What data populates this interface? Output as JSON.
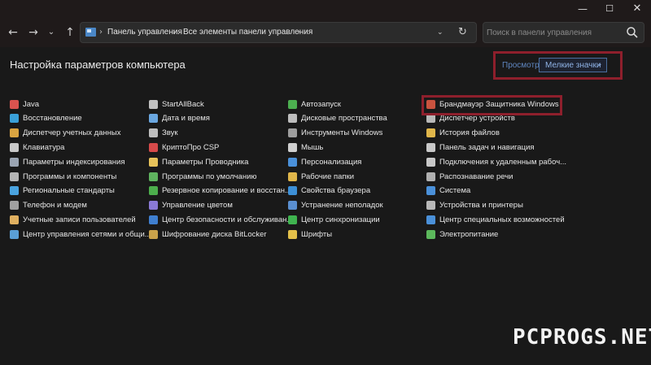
{
  "window": {
    "minimize_glyph": "—",
    "maximize_glyph": "☐",
    "close_glyph": "✕"
  },
  "nav": {
    "back_glyph": "←",
    "forward_glyph": "→",
    "recent_glyph": "⌄",
    "up_glyph": "↑"
  },
  "address": {
    "crumbs": [
      "Панель управления",
      "Все элементы панели управления"
    ],
    "separator": "›",
    "dropdown_glyph": "⌄",
    "refresh_glyph": "↻"
  },
  "search": {
    "placeholder": "Поиск в панели управления"
  },
  "header": {
    "title": "Настройка параметров компьютера",
    "view_label": "Просмотр:",
    "view_value": "Мелкие значки",
    "view_arrow": "⌄"
  },
  "items": {
    "col1": [
      {
        "label": "Java",
        "icon": "java-icon",
        "color": "#d9534f"
      },
      {
        "label": "Восстановление",
        "icon": "recovery-icon",
        "color": "#3aa0d8"
      },
      {
        "label": "Диспетчер учетных данных",
        "icon": "credential-manager-icon",
        "color": "#d9a441"
      },
      {
        "label": "Клавиатура",
        "icon": "keyboard-icon",
        "color": "#c8c8c8"
      },
      {
        "label": "Параметры индексирования",
        "icon": "indexing-icon",
        "color": "#9aa4b2"
      },
      {
        "label": "Программы и компоненты",
        "icon": "programs-icon",
        "color": "#b5b5b5"
      },
      {
        "label": "Региональные стандарты",
        "icon": "region-icon",
        "color": "#4aa3df"
      },
      {
        "label": "Телефон и модем",
        "icon": "phone-modem-icon",
        "color": "#a0a0a0"
      },
      {
        "label": "Учетные записи пользователей",
        "icon": "user-accounts-icon",
        "color": "#e0b060"
      },
      {
        "label": "Центр управления сетями и общи...",
        "icon": "network-center-icon",
        "color": "#5a9fd6"
      }
    ],
    "col2": [
      {
        "label": "StartAllBack",
        "icon": "startallback-icon",
        "color": "#c0c0c0"
      },
      {
        "label": "Дата и время",
        "icon": "date-time-icon",
        "color": "#6aa7e0"
      },
      {
        "label": "Звук",
        "icon": "sound-icon",
        "color": "#bdbdbd"
      },
      {
        "label": "КриптоПро CSP",
        "icon": "cryptopro-icon",
        "color": "#d64a4a"
      },
      {
        "label": "Параметры Проводника",
        "icon": "explorer-options-icon",
        "color": "#e6c25a"
      },
      {
        "label": "Программы по умолчанию",
        "icon": "default-programs-icon",
        "color": "#5fb35f"
      },
      {
        "label": "Резервное копирование и восстан...",
        "icon": "backup-icon",
        "color": "#4cae4c"
      },
      {
        "label": "Управление цветом",
        "icon": "color-management-icon",
        "color": "#8a7ad6"
      },
      {
        "label": "Центр безопасности и обслуживан...",
        "icon": "security-center-icon",
        "color": "#3f7fd0"
      },
      {
        "label": "Шифрование диска BitLocker",
        "icon": "bitlocker-icon",
        "color": "#c9a24a"
      }
    ],
    "col3": [
      {
        "label": "Автозапуск",
        "icon": "autoplay-icon",
        "color": "#4caf50"
      },
      {
        "label": "Дисковые пространства",
        "icon": "storage-spaces-icon",
        "color": "#bdbdbd"
      },
      {
        "label": "Инструменты Windows",
        "icon": "windows-tools-icon",
        "color": "#9e9e9e"
      },
      {
        "label": "Мышь",
        "icon": "mouse-icon",
        "color": "#d0d0d0"
      },
      {
        "label": "Персонализация",
        "icon": "personalization-icon",
        "color": "#4a90d9"
      },
      {
        "label": "Рабочие папки",
        "icon": "work-folders-icon",
        "color": "#e0b64a"
      },
      {
        "label": "Свойства браузера",
        "icon": "internet-options-icon",
        "color": "#3d8fd6"
      },
      {
        "label": "Устранение неполадок",
        "icon": "troubleshooting-icon",
        "color": "#5a8fd0"
      },
      {
        "label": "Центр синхронизации",
        "icon": "sync-center-icon",
        "color": "#3fb34f"
      },
      {
        "label": "Шрифты",
        "icon": "fonts-icon",
        "color": "#e3c04a"
      }
    ],
    "col4": [
      {
        "label": "Брандмауэр Защитника Windows",
        "icon": "firewall-icon",
        "color": "#c9533f"
      },
      {
        "label": "Диспетчер устройств",
        "icon": "device-manager-icon",
        "color": "#b8b8b8"
      },
      {
        "label": "История файлов",
        "icon": "file-history-icon",
        "color": "#e0b64a"
      },
      {
        "label": "Панель задач и навигация",
        "icon": "taskbar-icon",
        "color": "#c8c8c8"
      },
      {
        "label": "Подключения к удаленным рабоч...",
        "icon": "remote-desktop-icon",
        "color": "#c8c8c8"
      },
      {
        "label": "Распознавание речи",
        "icon": "speech-recognition-icon",
        "color": "#b0b0b0"
      },
      {
        "label": "Система",
        "icon": "system-icon",
        "color": "#4a90d9"
      },
      {
        "label": "Устройства и принтеры",
        "icon": "devices-printers-icon",
        "color": "#b8b8b8"
      },
      {
        "label": "Центр специальных возможностей",
        "icon": "ease-of-access-icon",
        "color": "#4a90d9"
      },
      {
        "label": "Электропитание",
        "icon": "power-options-icon",
        "color": "#5cb85c"
      }
    ]
  },
  "watermark": {
    "text": "PCPROGS.NET"
  },
  "colors": {
    "highlight": "#8e1f2c",
    "link": "#5f86c0",
    "background": "#191919"
  }
}
